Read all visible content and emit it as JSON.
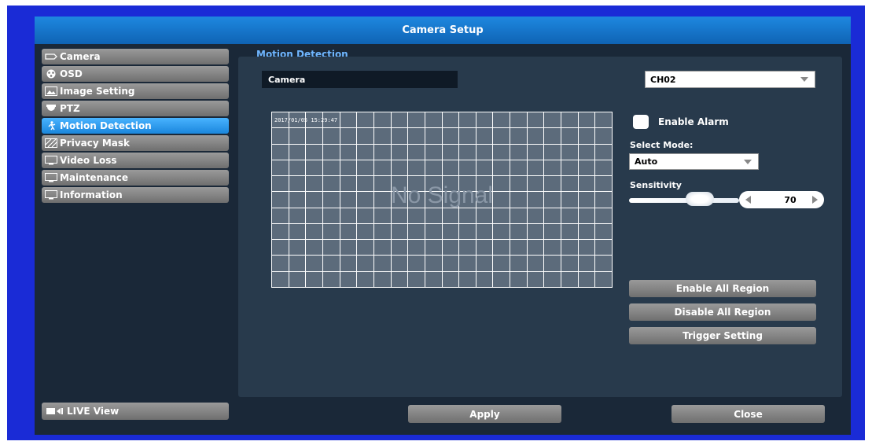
{
  "window": {
    "title": "Camera Setup"
  },
  "sidebar": {
    "items": [
      {
        "label": "Camera",
        "icon": "camera-icon"
      },
      {
        "label": "OSD",
        "icon": "osd-icon"
      },
      {
        "label": "Image Setting",
        "icon": "image-icon"
      },
      {
        "label": "PTZ",
        "icon": "ptz-icon"
      },
      {
        "label": "Motion Detection",
        "icon": "motion-icon",
        "active": true
      },
      {
        "label": "Privacy Mask",
        "icon": "privacy-mask-icon"
      },
      {
        "label": "Video Loss",
        "icon": "monitor-icon"
      },
      {
        "label": "Maintenance",
        "icon": "monitor-icon"
      },
      {
        "label": "Information",
        "icon": "monitor-icon"
      }
    ],
    "live_view": "LIVE View"
  },
  "main": {
    "section_title": "Motion Detection",
    "camera_label": "Camera",
    "channel_select": "CH02",
    "preview": {
      "timestamp": "2017/01/05 15:29:47",
      "no_signal": "No Signal"
    },
    "enable_alarm_label": "Enable Alarm",
    "enable_alarm_checked": false,
    "select_mode_label": "Select Mode:",
    "mode_value": "Auto",
    "sensitivity_label": "Sensitivity",
    "sensitivity_value": "70",
    "buttons": {
      "enable_all": "Enable All Region",
      "disable_all": "Disable All Region",
      "trigger": "Trigger Setting"
    }
  },
  "footer": {
    "apply": "Apply",
    "close": "Close"
  },
  "colors": {
    "frame": "#1a2bd6",
    "title_bar": "#1e88e0",
    "active_item": "#2fa0f5",
    "panel": "#283a4c",
    "link": "#6fb6ff"
  }
}
